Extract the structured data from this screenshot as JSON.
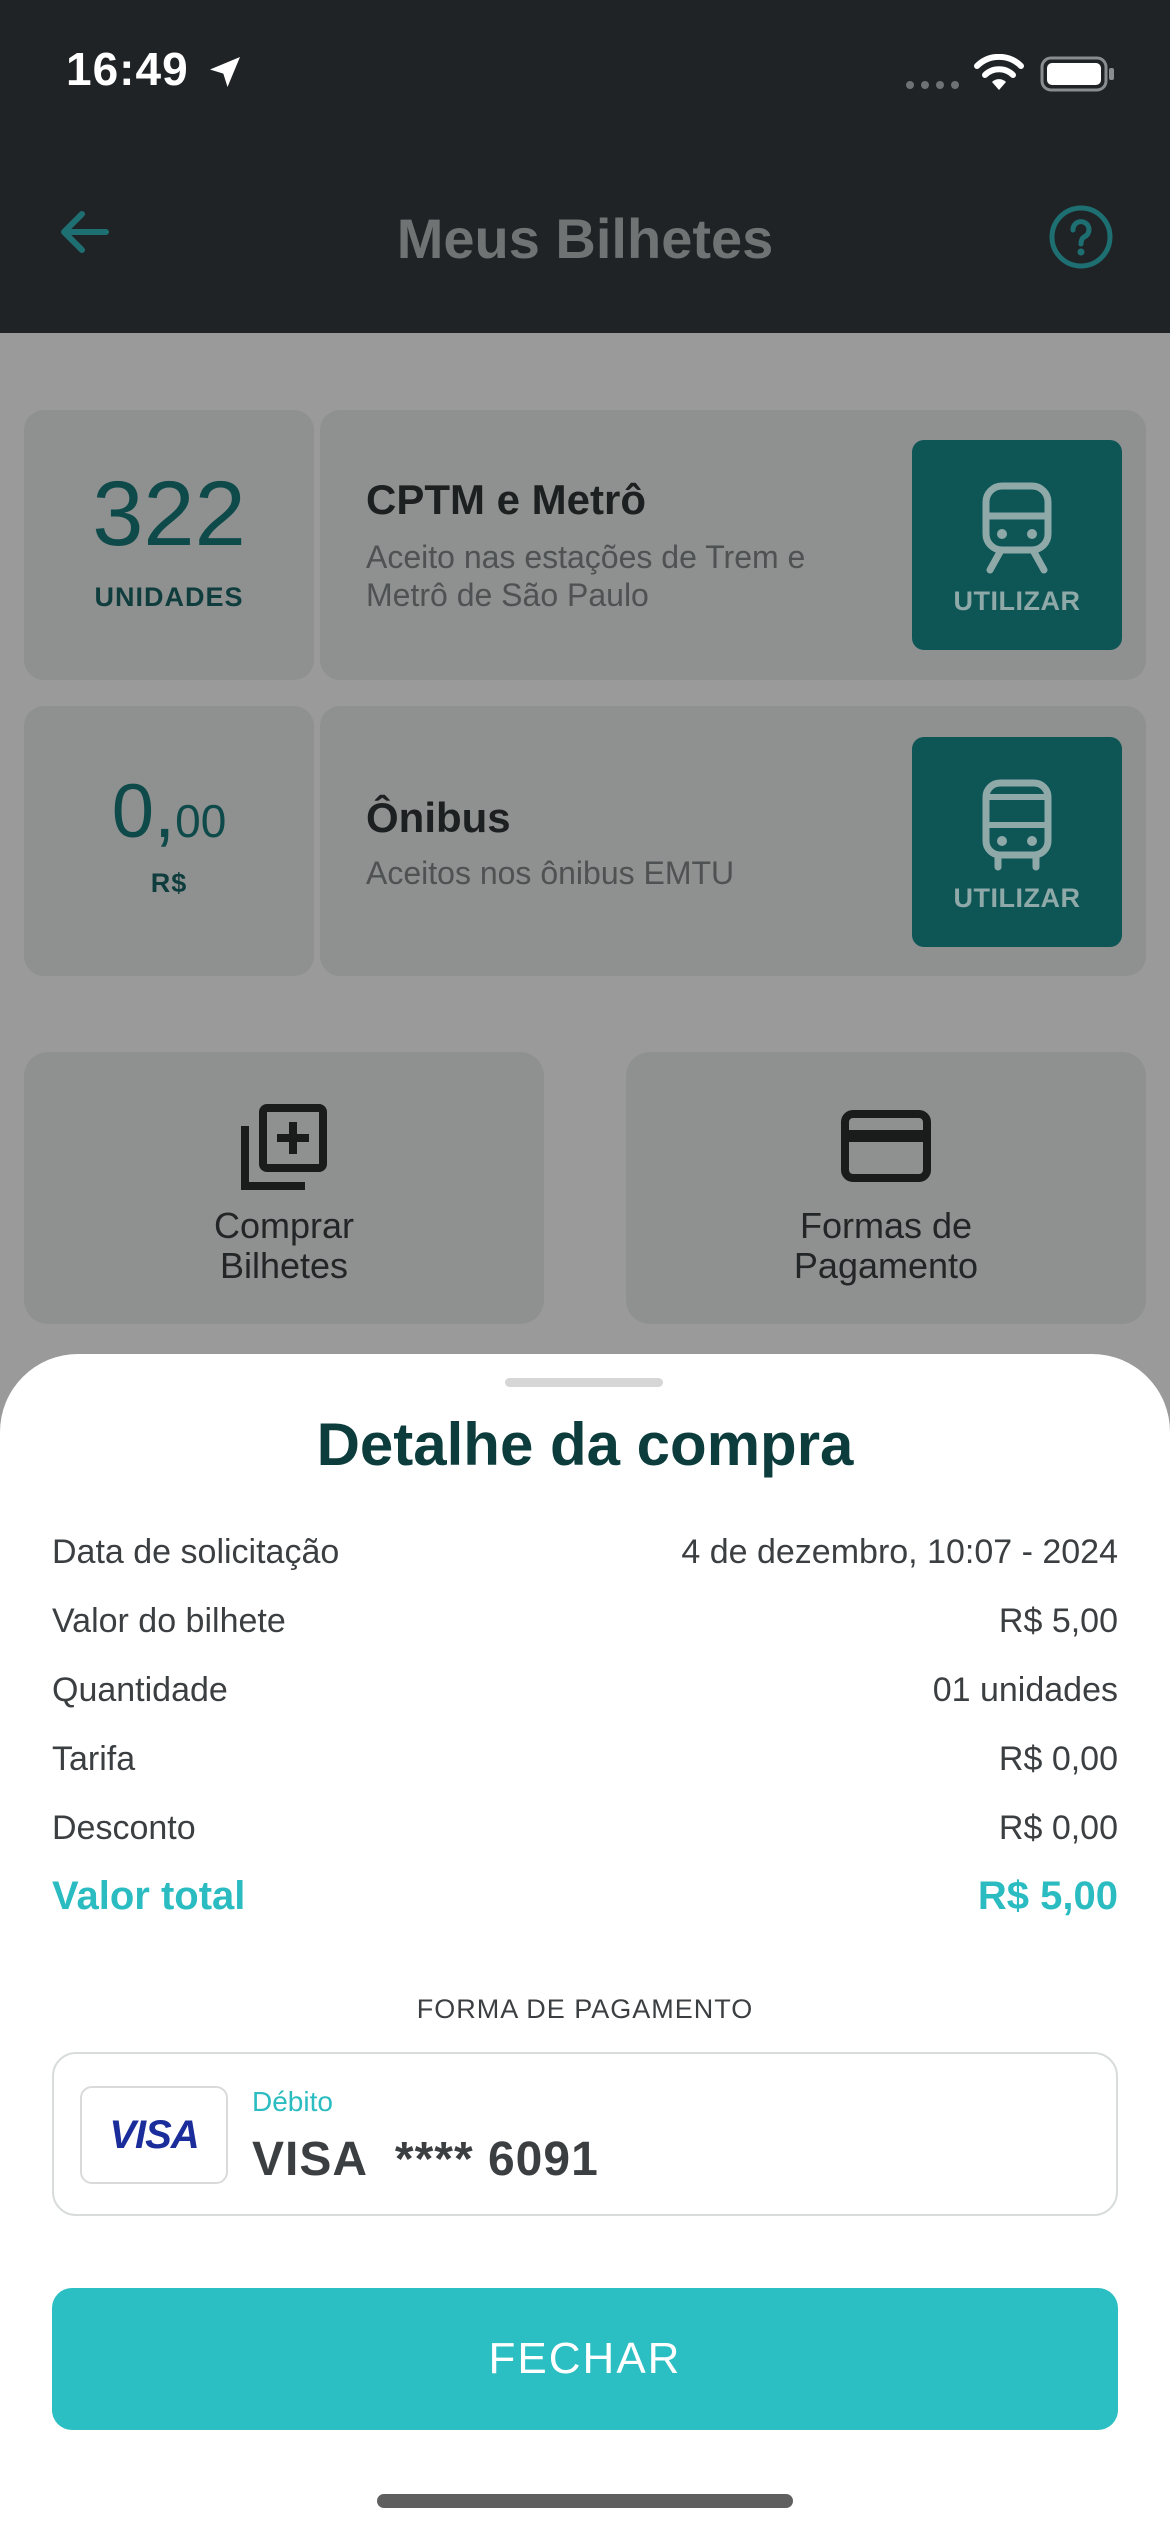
{
  "status_bar": {
    "time": "16:49"
  },
  "header": {
    "title": "Meus Bilhetes"
  },
  "tickets": [
    {
      "balance_value": "322",
      "balance_unit": "UNIDADES",
      "name": "CPTM e Metrô",
      "description": "Aceito nas estações de Trem e Metrô de São Paulo",
      "button_label": "UTILIZAR"
    },
    {
      "balance_int": "0,",
      "balance_cents": "00",
      "balance_unit": "R$",
      "name": "Ônibus",
      "description": "Aceitos nos ônibus EMTU",
      "button_label": "UTILIZAR"
    }
  ],
  "actions": {
    "buy_line1": "Comprar",
    "buy_line2": "Bilhetes",
    "payment_line1": "Formas de",
    "payment_line2": "Pagamento"
  },
  "sheet": {
    "title": "Detalhe da compra",
    "rows": [
      {
        "label": "Data de solicitação",
        "value": "4 de dezembro, 10:07 - 2024"
      },
      {
        "label": "Valor do bilhete",
        "value": "R$ 5,00"
      },
      {
        "label": "Quantidade",
        "value": "01 unidades"
      },
      {
        "label": "Tarifa",
        "value": "R$ 0,00"
      },
      {
        "label": "Desconto",
        "value": "R$ 0,00"
      }
    ],
    "total": {
      "label": "Valor total",
      "value": "R$ 5,00"
    },
    "payment_heading": "FORMA DE PAGAMENTO",
    "payment": {
      "brand_logo": "VISA",
      "type": "Débito",
      "card_text": "VISA  **** 6091"
    },
    "close_label": "FECHAR"
  },
  "colors": {
    "accent": "#2bbcc1",
    "dark_header": "#1f2326",
    "ticket_button": "#0e5556",
    "title_dark_teal": "#0c3c3c"
  },
  "icons": [
    "location-arrow-icon",
    "signal-icon",
    "wifi-icon",
    "battery-icon",
    "back-arrow-icon",
    "help-icon",
    "train-icon",
    "bus-icon",
    "add-to-queue-icon",
    "credit-card-icon"
  ]
}
